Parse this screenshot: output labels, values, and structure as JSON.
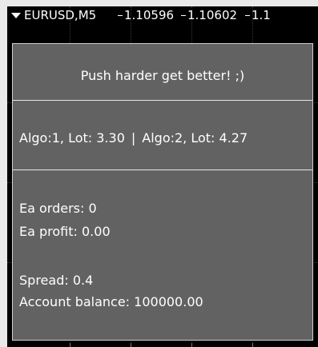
{
  "chart_window": {
    "symbol": "EURUSD,M5",
    "quote_1": "1.10596",
    "quote_2": "1.10602",
    "quote_3": "1.1"
  },
  "info_panel": {
    "motto": "Push harder get better! ;)",
    "algos": {
      "algo1": "Algo:1, Lot: 3.30",
      "separator": "|",
      "algo2": "Algo:2, Lot: 4.27"
    },
    "stats": {
      "ea_orders": "Ea orders: 0",
      "ea_profit": "Ea profit: 0.00",
      "spread": "Spread: 0.4",
      "account_balance": "Account balance: 100000.00"
    }
  },
  "colors": {
    "chart_background": "#000000",
    "panel_background": "#626262",
    "panel_border": "#cfcfcf",
    "text": "#ffffff"
  }
}
